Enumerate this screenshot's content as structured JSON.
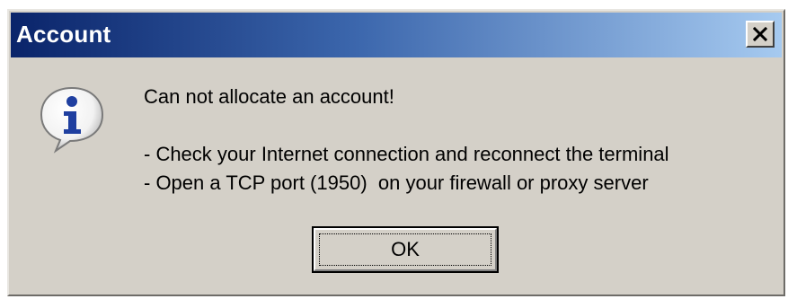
{
  "window": {
    "title": "Account",
    "close_icon": "close-icon"
  },
  "dialog": {
    "icon": "information-icon",
    "message_title": "Can not allocate an account!",
    "message_lines": [
      "- Check your Internet connection and reconnect the terminal",
      "- Open a TCP port (1950)  on your firewall or proxy server"
    ],
    "ok_label": "OK"
  },
  "colors": {
    "titlebar_start": "#0a246a",
    "titlebar_end": "#a6caf0",
    "dialog_background": "#d4d0c8",
    "icon_blue": "#1f3fa0"
  }
}
